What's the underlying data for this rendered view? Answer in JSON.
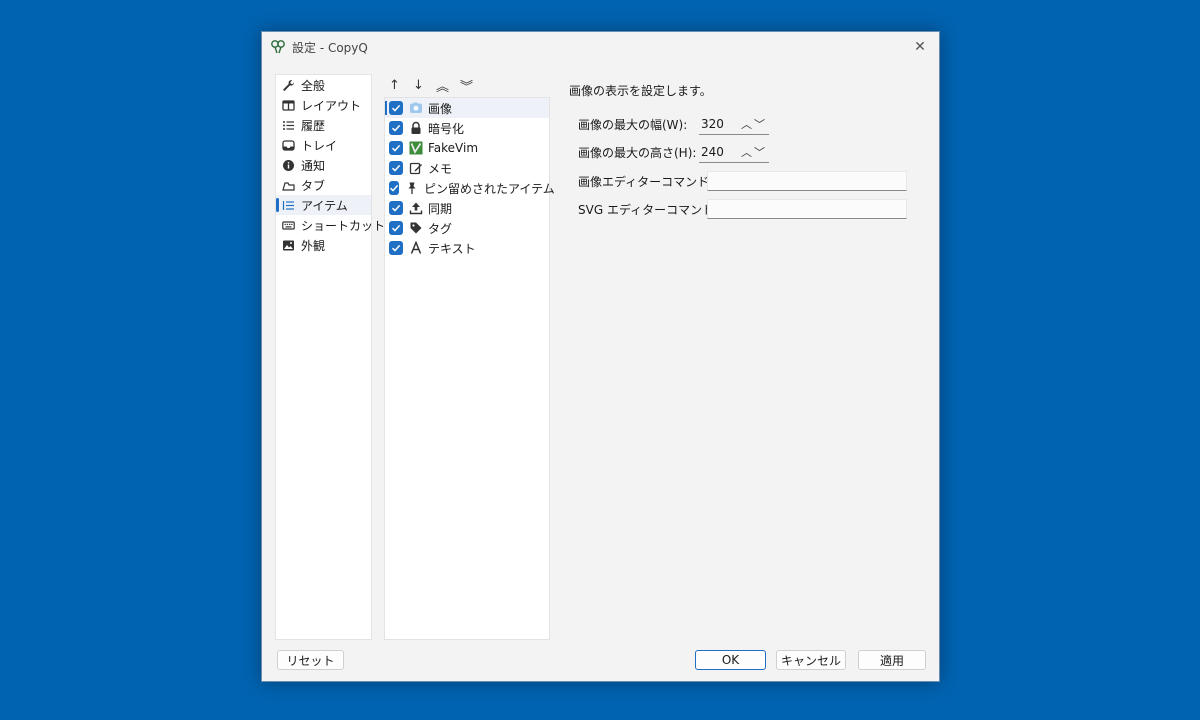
{
  "window": {
    "title": "設定 - CopyQ"
  },
  "nav": {
    "items": [
      {
        "label": "全般",
        "icon": "wrench-icon"
      },
      {
        "label": "レイアウト",
        "icon": "columns-icon"
      },
      {
        "label": "履歴",
        "icon": "list-icon"
      },
      {
        "label": "トレイ",
        "icon": "tray-icon"
      },
      {
        "label": "通知",
        "icon": "info-icon"
      },
      {
        "label": "タブ",
        "icon": "tabs-icon"
      },
      {
        "label": "アイテム",
        "icon": "item-list-icon",
        "selected": true
      },
      {
        "label": "ショートカット",
        "icon": "keyboard-icon"
      },
      {
        "label": "外観",
        "icon": "image-icon"
      }
    ]
  },
  "toolbar": {
    "buttons": [
      {
        "icon": "arrow-up-icon",
        "glyph": "↑"
      },
      {
        "icon": "arrow-down-icon",
        "glyph": "↓"
      },
      {
        "icon": "double-chevron-up-icon",
        "glyph": "︽"
      },
      {
        "icon": "double-chevron-down-icon",
        "glyph": "︾"
      }
    ]
  },
  "plugins": {
    "items": [
      {
        "label": "画像",
        "icon": "image-icon",
        "checked": true,
        "selected": true
      },
      {
        "label": "暗号化",
        "icon": "lock-icon",
        "checked": true
      },
      {
        "label": "FakeVim",
        "icon": "fakevim-icon",
        "checked": true
      },
      {
        "label": "メモ",
        "icon": "note-edit-icon",
        "checked": true
      },
      {
        "label": "ピン留めされたアイテム",
        "icon": "pin-icon",
        "checked": true
      },
      {
        "label": "同期",
        "icon": "upload-icon",
        "checked": true
      },
      {
        "label": "タグ",
        "icon": "tag-icon",
        "checked": true
      },
      {
        "label": "テキスト",
        "icon": "text-icon",
        "checked": true
      }
    ]
  },
  "settings": {
    "description": "画像の表示を設定します。",
    "max_width_label": "画像の最大の幅(W):",
    "max_width_value": "320",
    "max_height_label": "画像の最大の高さ(H):",
    "max_height_value": "240",
    "image_editor_label": "画像エディターコマンド(I):",
    "image_editor_value": "",
    "svg_editor_label": "SVG エディターコマンド(S):",
    "svg_editor_value": ""
  },
  "buttons": {
    "reset": "リセット",
    "ok": "OK",
    "cancel": "キャンセル",
    "apply": "適用"
  },
  "colors": {
    "accent": "#1f6fc5",
    "desktop": "#0063b1"
  }
}
